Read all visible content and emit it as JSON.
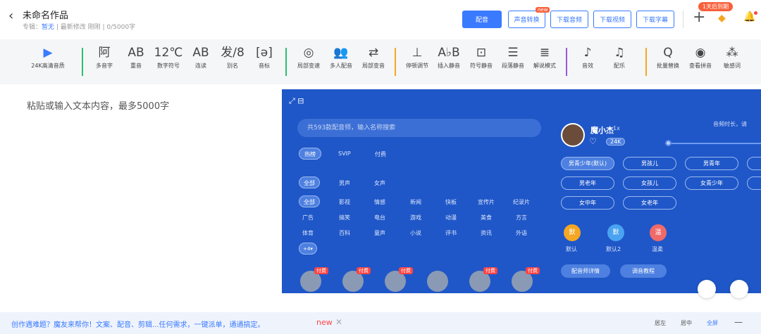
{
  "header": {
    "back_icon": "‹",
    "title": "未命名作品",
    "meta_prefix": "专辑：",
    "meta_album": "暂无",
    "meta_rest": "最新修改  刚刚  |  0/5000字"
  },
  "topbuttons": {
    "dub": "配音",
    "voice_convert": "声音转换",
    "new_tag": "new",
    "download_audio": "下载音频",
    "download_video": "下载视频",
    "download_subtitle": "下载字幕",
    "expire": "1天后到期"
  },
  "toolbar": [
    {
      "icon": "▶",
      "label": "24K高清音质"
    },
    {
      "icon": "阿",
      "label": "多音字"
    },
    {
      "icon": "AB",
      "label": "重音"
    },
    {
      "icon": "12℃",
      "label": "数字符号"
    },
    {
      "icon": "AB",
      "label": "连读"
    },
    {
      "icon": "发/8",
      "label": "别名"
    },
    {
      "icon": "[ə]",
      "label": "音标"
    },
    {
      "icon": "◎",
      "label": "局部变速"
    },
    {
      "icon": "👥",
      "label": "多人配音"
    },
    {
      "icon": "⇄",
      "label": "局部变音"
    },
    {
      "icon": "⊥",
      "label": "停顿调节"
    },
    {
      "icon": "A♭B",
      "label": "插入静音"
    },
    {
      "icon": "⊡",
      "label": "符号静音"
    },
    {
      "icon": "☰",
      "label": "段落静音"
    },
    {
      "icon": "≣",
      "label": "解说模式"
    },
    {
      "icon": "♪",
      "label": "音效"
    },
    {
      "icon": "♫",
      "label": "配乐"
    },
    {
      "icon": "Q",
      "label": "批量替换"
    },
    {
      "icon": "◉",
      "label": "查看拼音"
    },
    {
      "icon": "⁂",
      "label": "敏感词"
    }
  ],
  "editor": {
    "placeholder": "粘贴或输入文本内容，最多5000字"
  },
  "panel": {
    "icons": "⤢  ⊟",
    "search_placeholder": "共593款配音师，输入名称搜索",
    "tabs": [
      "热榜",
      "SVIP",
      "付费"
    ],
    "gender": [
      "全部",
      "男声",
      "女声"
    ],
    "categories": [
      "全部",
      "影视",
      "情感",
      "新闻",
      "快板",
      "宣传片",
      "纪录片",
      "广告",
      "搞笑",
      "电台",
      "游戏",
      "动漫",
      "美食",
      "方言",
      "体育",
      "百科",
      "童声",
      "小说",
      "评书",
      "资讯",
      "外语",
      "+4▾"
    ],
    "paid_label": "付费",
    "voice_name": "魔小杰",
    "voice_speed": "1x",
    "quality": "24K",
    "duration_label": "音频时长，请",
    "styles": [
      "男青少年(默认)",
      "男孩儿",
      "男青年",
      "男老年",
      "女孩儿",
      "女青少年",
      "女中年",
      "女老年"
    ],
    "emotions": [
      {
        "icon": "默",
        "label": "默认",
        "color": "#f5a623"
      },
      {
        "icon": "默",
        "label": "默认2",
        "color": "#4aa3f0"
      },
      {
        "icon": "温",
        "label": "温柔",
        "color": "#f06a6a"
      }
    ],
    "buttons": [
      "配音师详情",
      "调音教程"
    ]
  },
  "bottom": {
    "promo": "创作遇难题？魔友来帮你！文案、配音、剪辑...任何需求，一键派单，通通搞定。",
    "new": "new",
    "close": "✕",
    "align_left": "居左",
    "align_center": "居中",
    "align_full": "全屏",
    "minus": "—"
  }
}
